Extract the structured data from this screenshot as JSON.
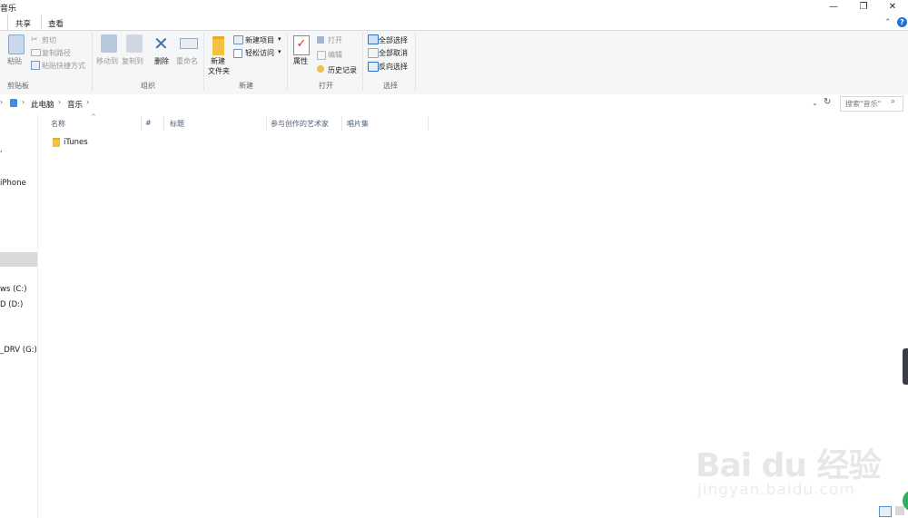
{
  "window": {
    "title": "音乐",
    "minimize_glyph": "—",
    "restore_glyph": "❐",
    "close_glyph": "✕"
  },
  "ribbon_tabs": [
    "共享",
    "查看"
  ],
  "ribbon": {
    "clipboard": {
      "paste": "粘贴",
      "cut": "剪切",
      "copy_path": "复制路径",
      "paste_shortcut": "粘贴快捷方式",
      "label": "剪贴板"
    },
    "organize": {
      "move_to": "移动到",
      "copy_to": "复制到",
      "delete": "删除",
      "rename": "重命名",
      "label": "组织"
    },
    "new": {
      "new_item": "新建项目",
      "easy_access": "轻松访问",
      "new_folder_l1": "新建",
      "new_folder_l2": "文件夹",
      "label": "新建"
    },
    "open": {
      "properties": "属性",
      "open": "打开",
      "edit": "编辑",
      "history": "历史记录",
      "label": "打开"
    },
    "select": {
      "select_all": "全部选择",
      "select_none": "全部取消",
      "invert": "反向选择",
      "label": "选择"
    }
  },
  "address": {
    "crumb_pc": "此电脑",
    "crumb_music": "音乐",
    "search_placeholder": "搜索\"音乐\""
  },
  "nav": {
    "items": [
      "iPhone",
      "ws (C:)",
      "D (D:)",
      "_DRV (G:)"
    ]
  },
  "columns": [
    "名称",
    "#",
    "标题",
    "参与创作的艺术家",
    "唱片集"
  ],
  "files": [
    {
      "name": "iTunes",
      "type": "folder"
    }
  ],
  "watermark": {
    "main": "Bai du 经验",
    "sub": "jingyan.baidu.com"
  },
  "colors": {
    "ribbon_bg": "#f5f6f7",
    "accent_blue": "#1e72d8",
    "folder_yellow": "#f4c243"
  }
}
